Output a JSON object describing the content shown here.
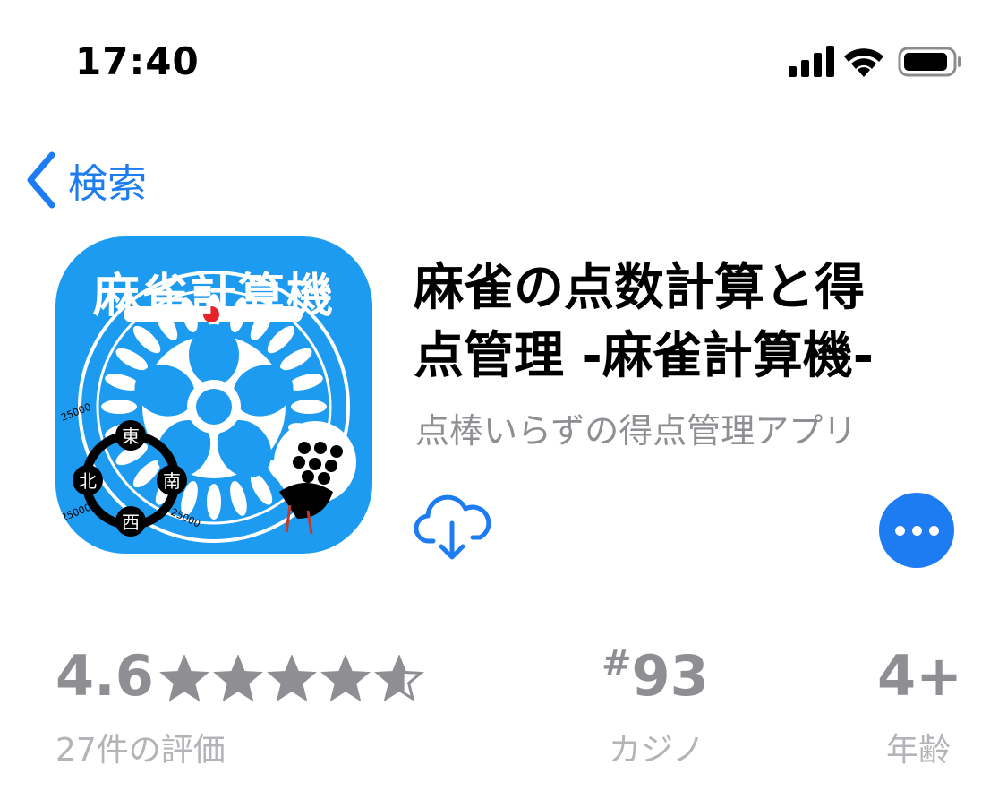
{
  "status_bar": {
    "time": "17:40",
    "icons": [
      "cellular-signal-icon",
      "wifi-icon",
      "battery-icon"
    ]
  },
  "nav": {
    "back_label": "検索",
    "back_icon": "chevron-left-icon"
  },
  "app": {
    "icon_title": "麻雀計算機",
    "icon_winds": [
      "東",
      "南",
      "西",
      "北"
    ],
    "icon_score_labels": [
      "25000",
      "25000",
      "25000"
    ],
    "title_line1": "麻雀の点数計算と得",
    "title_line2": "点管理 -麻雀計算機-",
    "subtitle": "点棒いらずの得点管理アプリ",
    "download_icon": "cloud-download-icon",
    "more_icon": "ellipsis-icon"
  },
  "stats": {
    "rating": "4.6",
    "rating_stars": 4.6,
    "rating_count": "27件の評価",
    "rank_hash": "#",
    "rank_number": "93",
    "rank_category": "カジノ",
    "age": "4+",
    "age_label": "年齢"
  },
  "colors": {
    "accent": "#1e7cf2",
    "icon_background": "#1c9bf0",
    "secondary_text": "#8e8e93"
  }
}
